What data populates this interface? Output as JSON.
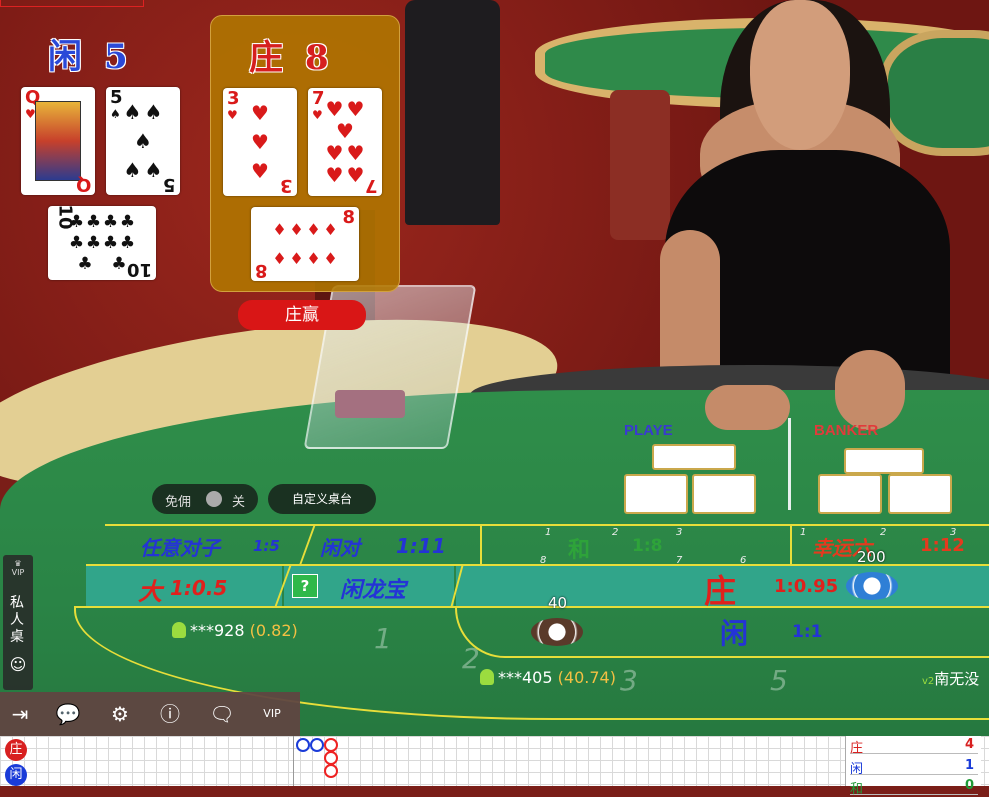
{
  "player_hand": {
    "label": "闲",
    "score": "5",
    "cards": [
      {
        "rank": "Q",
        "suit": "♥",
        "color": "red"
      },
      {
        "rank": "5",
        "suit": "♠",
        "color": "black"
      },
      {
        "rank": "10",
        "suit": "♣",
        "color": "black"
      }
    ]
  },
  "banker_hand": {
    "label": "庄",
    "score": "8",
    "cards": [
      {
        "rank": "3",
        "suit": "♥",
        "color": "red"
      },
      {
        "rank": "7",
        "suit": "♥",
        "color": "red"
      },
      {
        "rank": "8",
        "suit": "♦",
        "color": "red"
      }
    ]
  },
  "result": "庄赢",
  "table_print": {
    "player": "PLAYE",
    "banker": "BANKER"
  },
  "commission_toggle": {
    "label": "免佣",
    "state": "关"
  },
  "custom_table_button": "自定义桌台",
  "bets": {
    "any_pair": {
      "label": "任意对子",
      "odds": "1:5"
    },
    "player_pair": {
      "label": "闲对",
      "odds": "1:11"
    },
    "tie": {
      "label": "和",
      "odds": "1:8"
    },
    "lucky_six": {
      "label": "幸运六",
      "odds": "1:12"
    },
    "big": {
      "label": "大",
      "odds": "1:0.5"
    },
    "player_dragon": {
      "label": "闲龙宝",
      "help": "?"
    },
    "banker": {
      "label": "庄",
      "odds": "1:0.95"
    },
    "player": {
      "label": "闲",
      "odds": "1:1"
    }
  },
  "seat_numbers": [
    "1",
    "2",
    "3",
    "5",
    "6",
    "7",
    "8"
  ],
  "chips": [
    {
      "amount": "40",
      "color": "#5a3a2a"
    },
    {
      "amount": "200",
      "color": "#2f7fd6"
    }
  ],
  "bettors": [
    {
      "name": "***928",
      "amount": "(0.82)"
    },
    {
      "name": "***405",
      "amount": "(40.74)"
    },
    {
      "name": "南无没",
      "amount": ""
    }
  ],
  "bettor_badge": "v2",
  "side_panel": {
    "vip": "VIP",
    "label": "私人桌"
  },
  "toolbar": [
    {
      "name": "exit-icon",
      "glyph": "⇥"
    },
    {
      "name": "chat-icon",
      "glyph": "💬"
    },
    {
      "name": "settings-icon",
      "glyph": "⚙"
    },
    {
      "name": "info-icon",
      "glyph": "ⓘ"
    },
    {
      "name": "dealer-chat-icon",
      "glyph": "🗨"
    },
    {
      "name": "vip-icon",
      "glyph": "VIP"
    }
  ],
  "roadmap": {
    "labels": [
      {
        "text": "庄",
        "color": "#d82020"
      },
      {
        "text": "闲",
        "color": "#1a3bd8"
      }
    ],
    "stats": [
      {
        "label": "庄",
        "value": "4",
        "color": "#d82020"
      },
      {
        "label": "闲",
        "value": "1",
        "color": "#1a3bd8"
      },
      {
        "label": "和",
        "value": "0",
        "color": "#1f9a36"
      }
    ]
  },
  "colors": {
    "banker_red": "#d61f1f",
    "player_blue": "#2a49d8",
    "felt_green": "#2f8e4a",
    "line_yellow": "#e7de3a"
  }
}
